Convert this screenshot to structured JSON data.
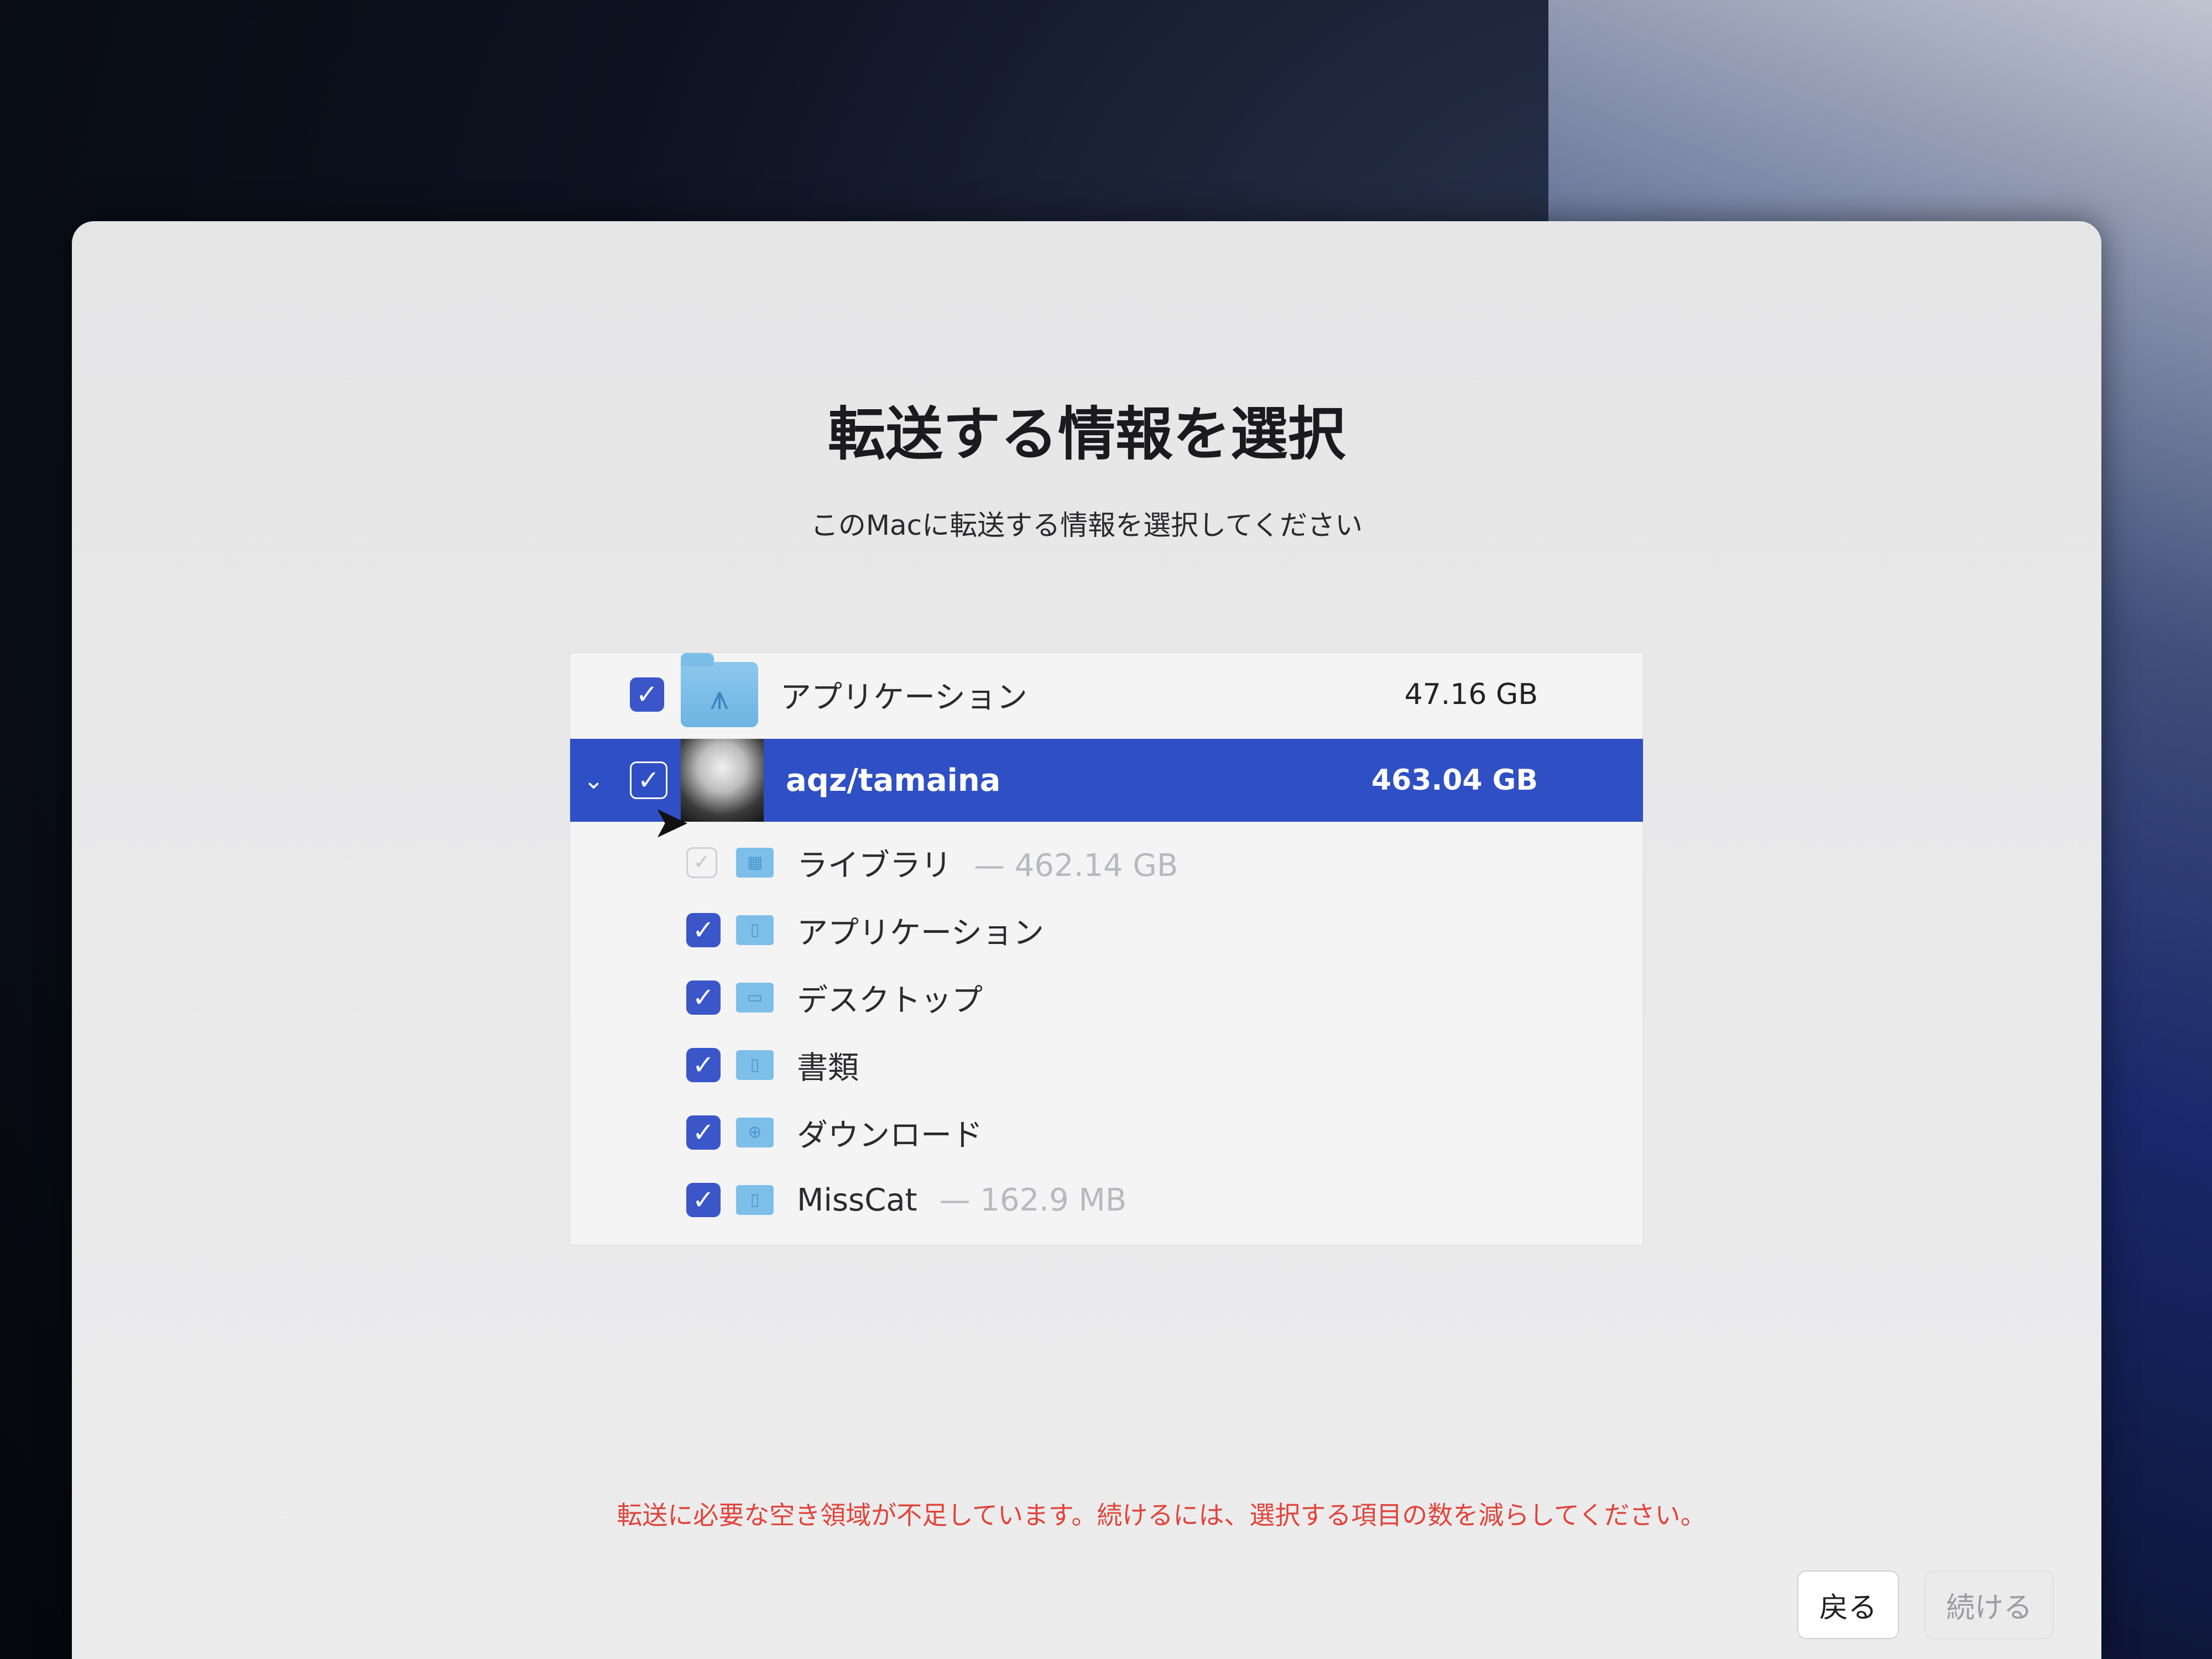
{
  "header": {
    "title": "転送する情報を選択",
    "subtitle": "このMacに転送する情報を選択してください"
  },
  "items": [
    {
      "label": "アプリケーション",
      "size": "47.16 GB",
      "checked": true,
      "icon": "app-folder-icon"
    },
    {
      "label": "aqz/tamaina",
      "size": "463.04 GB",
      "checked": true,
      "selected": true,
      "expanded": true,
      "icon": "user-avatar"
    }
  ],
  "subitems": [
    {
      "label": "ライブラリ",
      "size": "— 462.14 GB",
      "checked": true,
      "disabled": true
    },
    {
      "label": "アプリケーション",
      "size": "",
      "checked": true
    },
    {
      "label": "デスクトップ",
      "size": "",
      "checked": true
    },
    {
      "label": "書類",
      "size": "",
      "checked": true
    },
    {
      "label": "ダウンロード",
      "size": "",
      "checked": true
    },
    {
      "label": "MissCat",
      "size": "— 162.9 MB",
      "checked": true
    }
  ],
  "warning": "転送に必要な空き領域が不足しています。続けるには、選択する項目の数を減らしてください。",
  "footer": {
    "back_label": "戻る",
    "continue_label": "続ける"
  },
  "colors": {
    "selection": "#2f4fc4",
    "checkbox": "#3a56c9",
    "folder": "#7dbfe8",
    "warning": "#e0453c"
  }
}
